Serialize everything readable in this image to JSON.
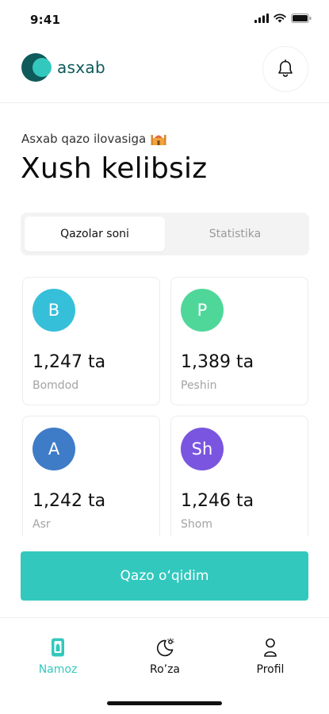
{
  "status_bar": {
    "time": "9:41"
  },
  "header": {
    "logo_text": "asxab",
    "notification_icon": "bell-icon"
  },
  "greeting": {
    "subtitle": "Asxab qazo ilovasiga",
    "subtitle_icon": "mosque-emoji",
    "title": "Xush kelibsiz"
  },
  "tabs": [
    {
      "label": "Qazolar soni",
      "active": true
    },
    {
      "label": "Statistika",
      "active": false
    }
  ],
  "prayers": [
    {
      "letter": "B",
      "count": "1,247 ta",
      "name": "Bomdod",
      "color": "#36bfd9"
    },
    {
      "letter": "P",
      "count": "1,389 ta",
      "name": "Peshin",
      "color": "#4fd79a"
    },
    {
      "letter": "A",
      "count": "1,242 ta",
      "name": "Asr",
      "color": "#3f7cc8"
    },
    {
      "letter": "Sh",
      "count": "1,246 ta",
      "name": "Shom",
      "color": "#7a55e0"
    }
  ],
  "cta": {
    "label": "Qazo o‘qidim",
    "color": "#33c8bd"
  },
  "bottom_nav": [
    {
      "label": "Namoz",
      "icon": "phone-icon",
      "active": true
    },
    {
      "label": "Ro’za",
      "icon": "moon-star-icon",
      "active": false
    },
    {
      "label": "Profil",
      "icon": "user-icon",
      "active": false
    }
  ],
  "colors": {
    "accent": "#33c8bd",
    "brand": "#0f5a5a"
  }
}
